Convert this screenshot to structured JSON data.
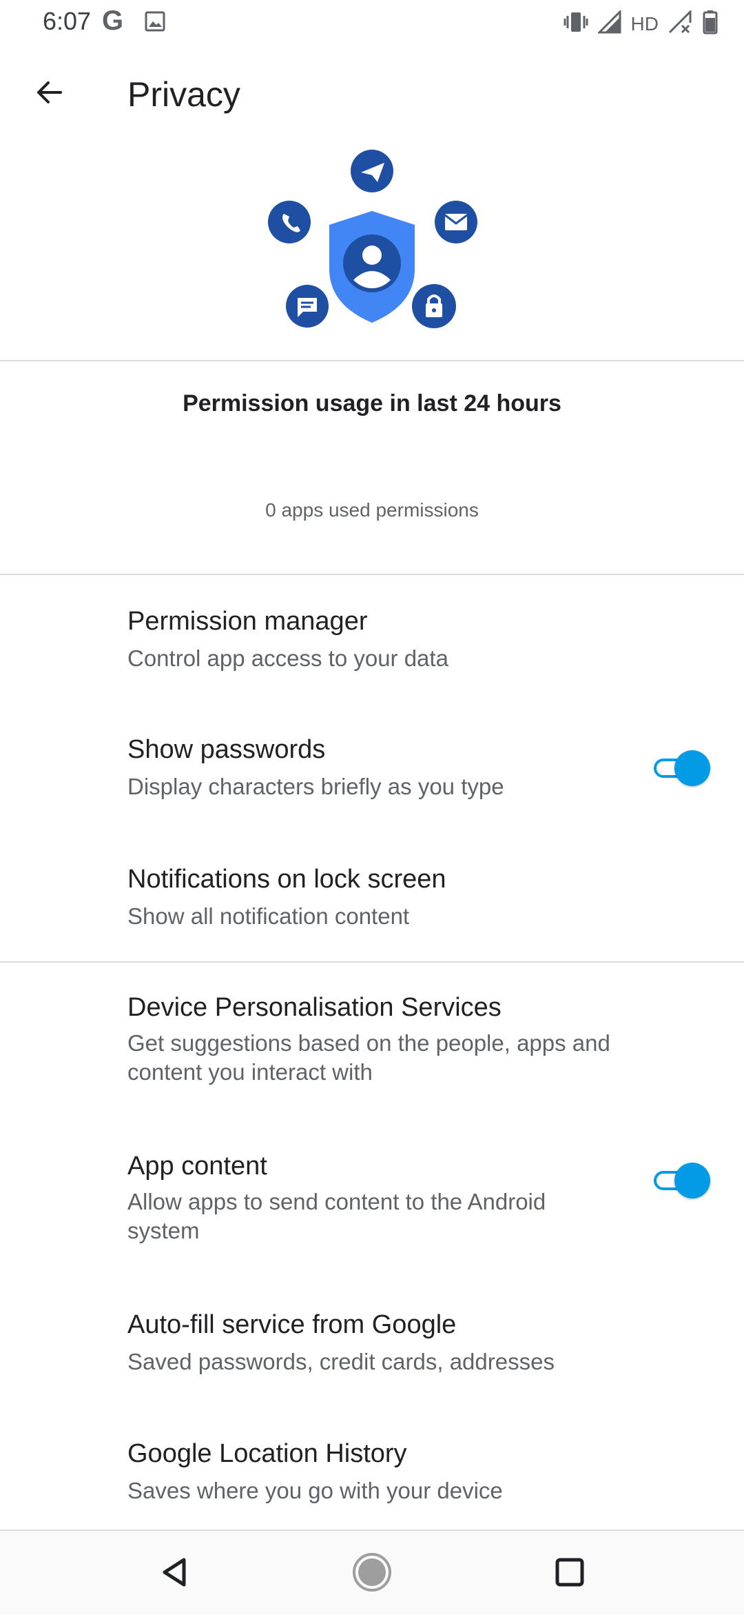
{
  "status_bar": {
    "time": "6:07",
    "google_letter": "G",
    "network_label": "HD",
    "icons": [
      "google-icon",
      "image-icon",
      "vibrate-icon",
      "signal-icon",
      "signal-no-data-icon",
      "battery-icon"
    ]
  },
  "header": {
    "title": "Privacy",
    "back_icon": "arrow-back-icon"
  },
  "hero_icons": [
    "send-icon",
    "phone-icon",
    "email-icon",
    "shield-person-icon",
    "message-icon",
    "lock-icon"
  ],
  "usage": {
    "title": "Permission usage in last 24 hours",
    "subtitle": "0 apps used permissions"
  },
  "items": [
    {
      "title": "Permission manager",
      "subtitle": "Control app access to your data"
    },
    {
      "title": "Show passwords",
      "subtitle": "Display characters briefly as you type",
      "toggle_on": true
    },
    {
      "title": "Notifications on lock screen",
      "subtitle": "Show all notification content"
    },
    {
      "title": "Device Personalisation Services",
      "subtitle": "Get suggestions based on the people, apps and content you interact with"
    },
    {
      "title": "App content",
      "subtitle": "Allow apps to send content to the Android system",
      "toggle_on": true
    },
    {
      "title": "Auto-fill service from Google",
      "subtitle": "Saved passwords, credit cards, addresses"
    },
    {
      "title": "Google Location History",
      "subtitle": "Saves where you go with your device"
    }
  ],
  "colors": {
    "accent": "#039be5",
    "hero_dark": "#1e4fa3",
    "hero_light": "#4285f4",
    "divider": "#dadce0"
  },
  "nav": [
    "back-nav-icon",
    "home-nav-icon",
    "recents-nav-icon"
  ]
}
